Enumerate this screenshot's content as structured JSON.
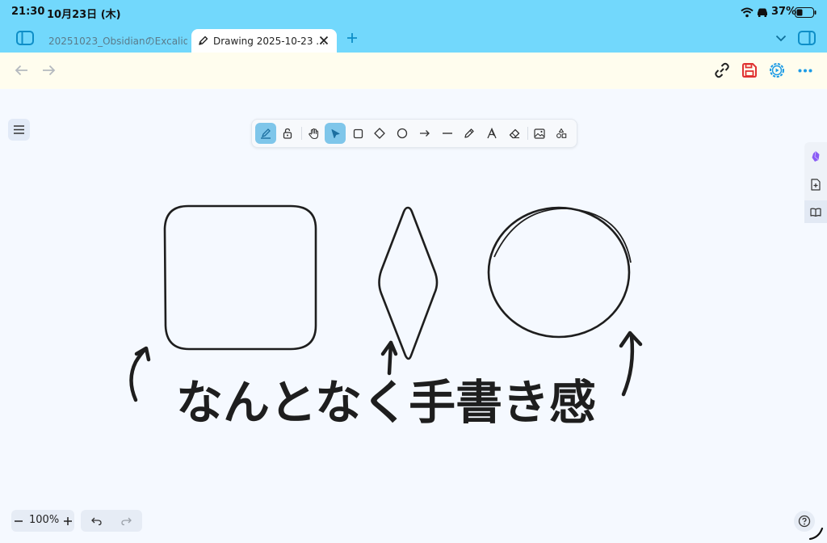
{
  "status": {
    "time": "21:30",
    "date": "10月23日 (木)",
    "battery": "37%"
  },
  "tabs": [
    {
      "label": "20251023_ObsidianのExcalid...",
      "active": false
    },
    {
      "label": "Drawing 2025-10-23 ...",
      "active": true
    }
  ],
  "zoom": {
    "level": "100%"
  },
  "drawing": {
    "annotation": "なんとなく手書き感"
  },
  "colors": {
    "accent": "#72d8fc",
    "save": "#e03131",
    "settings": "#1c9be6",
    "selected_tool": "#7fc6ea"
  },
  "tools": [
    {
      "icon": "pen-mode-icon",
      "selected": true
    },
    {
      "icon": "lock-icon",
      "selected": false
    },
    {
      "icon": "hand-icon",
      "selected": false
    },
    {
      "icon": "selection-arrow-icon",
      "selected": true
    },
    {
      "icon": "rectangle-icon",
      "selected": false
    },
    {
      "icon": "diamond-icon",
      "selected": false
    },
    {
      "icon": "ellipse-icon",
      "selected": false
    },
    {
      "icon": "arrow-icon",
      "selected": false
    },
    {
      "icon": "line-icon",
      "selected": false
    },
    {
      "icon": "pencil-icon",
      "selected": false
    },
    {
      "icon": "text-icon",
      "selected": false
    },
    {
      "icon": "eraser-icon",
      "selected": false
    },
    {
      "icon": "image-icon",
      "selected": false
    },
    {
      "icon": "shapes-library-icon",
      "selected": false
    }
  ]
}
